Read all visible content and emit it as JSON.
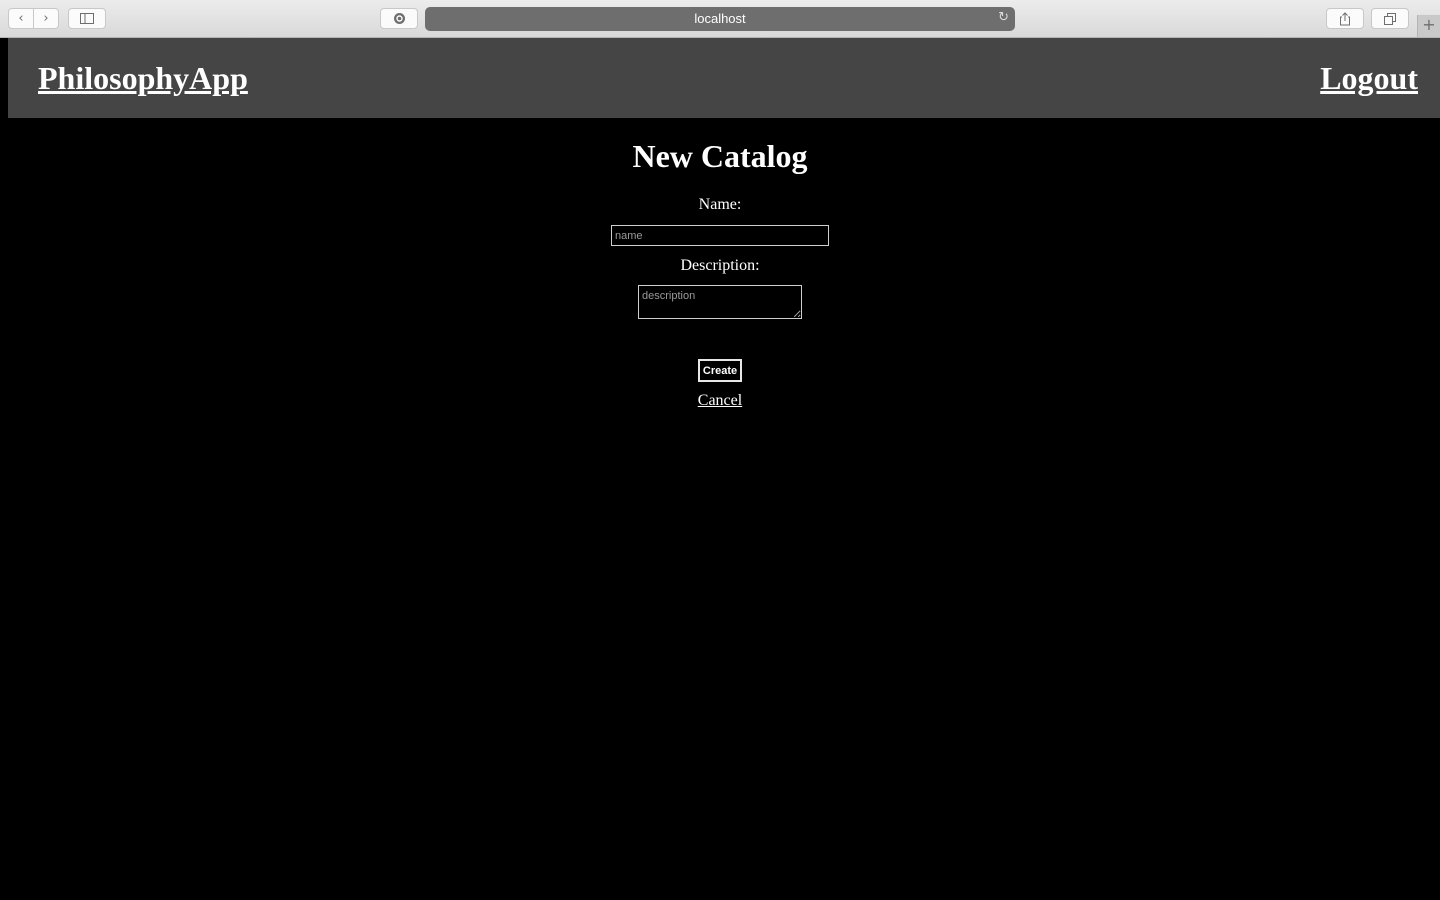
{
  "browser": {
    "url": "localhost",
    "back_icon": "chevron-left-icon",
    "forward_icon": "chevron-right-icon",
    "sidebar_icon": "sidebar-icon",
    "extension_icon": "circle-g-icon",
    "reload_icon": "reload-icon",
    "share_icon": "share-icon",
    "tabs_icon": "tabs-icon",
    "new_tab_icon": "plus-icon"
  },
  "header": {
    "brand": "PhilosophyApp",
    "logout": "Logout"
  },
  "form": {
    "title": "New Catalog",
    "name_label": "Name:",
    "name_placeholder": "name",
    "name_value": "",
    "description_label": "Description:",
    "description_placeholder": "description",
    "description_value": "",
    "create_label": "Create",
    "cancel_label": "Cancel"
  },
  "colors": {
    "page_background": "#000000",
    "header_background": "#454545",
    "text": "#ffffff"
  }
}
